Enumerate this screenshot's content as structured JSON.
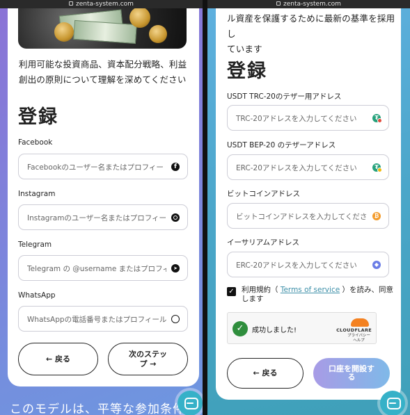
{
  "url": "zenta-system.com",
  "left": {
    "intro": "利用可能な投資商品、資本配分戦略、利益創出の原則について理解を深めてください",
    "title": "登録",
    "fields": [
      {
        "label": "Facebook",
        "placeholder": "Facebookのユーザー名またはプロフィー",
        "icon": "facebook-icon"
      },
      {
        "label": "Instagram",
        "placeholder": "Instagramのユーザー名またはプロフィー",
        "icon": "instagram-icon"
      },
      {
        "label": "Telegram",
        "placeholder": "Telegram の @username またはプロフィ",
        "icon": "telegram-icon"
      },
      {
        "label": "WhatsApp",
        "placeholder": "WhatsAppの電話番号またはプロフィール",
        "icon": "whatsapp-icon"
      }
    ],
    "back_button": "← 戻る",
    "next_button_line1": "次のステッ",
    "next_button_line2": "プ →",
    "footer_text": "このモデルは、平等な参加条件"
  },
  "right": {
    "intro_line1": "ル資産を保護するために最新の基準を採用し",
    "intro_line2": "ています",
    "title": "登録",
    "fields": [
      {
        "label": "USDT TRC-20のテザー用アドレス",
        "placeholder": "TRC-20アドレスを入力してください",
        "icon": "usdt-trc20-icon"
      },
      {
        "label": "USDT BEP-20 のテザーアドレス",
        "placeholder": "ERC-20アドレスを入力してください",
        "icon": "usdt-bep20-icon"
      },
      {
        "label": "ビットコインアドレス",
        "placeholder": "ビットコインアドレスを入力してくださ",
        "icon": "bitcoin-icon"
      },
      {
        "label": "イーサリアムアドレス",
        "placeholder": "ERC-20アドレスを入力してください",
        "icon": "ethereum-icon"
      }
    ],
    "terms_prefix": "利用規約（",
    "terms_link": "Terms of service",
    "terms_suffix": "）を読み、同意します",
    "captcha_status": "成功しました!",
    "captcha_brand": "CLOUDFLARE",
    "captcha_privacy": "プライバシー",
    "captcha_help": "ヘルプ",
    "back_button": "← 戻る",
    "submit_line1": "口座を開設す",
    "submit_line2": "る"
  },
  "colors": {
    "accent_teal": "#36b1c8",
    "captcha_success": "#2f8e3d",
    "cloudflare_orange": "#f48120"
  }
}
